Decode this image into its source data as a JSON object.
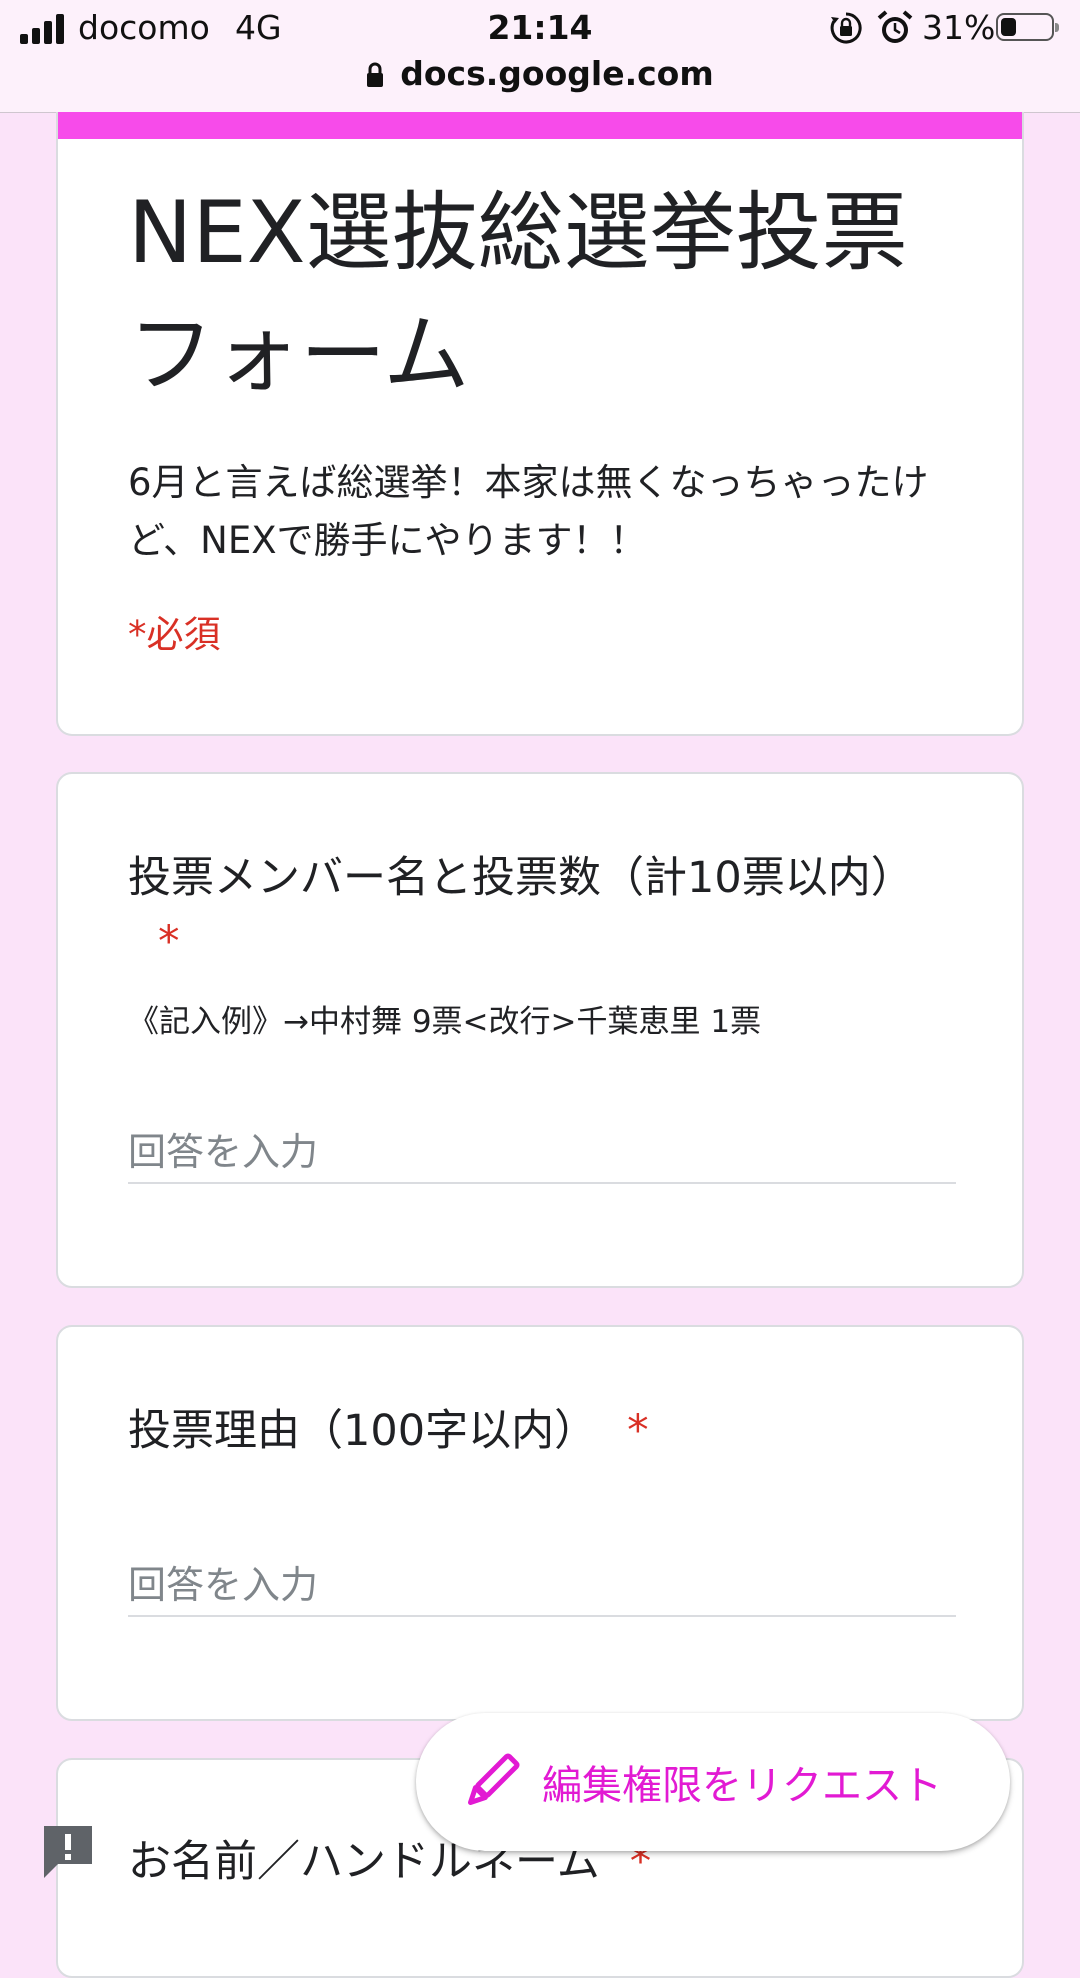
{
  "status_bar": {
    "carrier": "docomo",
    "network": "4G",
    "time": "21:14",
    "battery_percent": "31%",
    "battery_level": 0.31,
    "icons": [
      "signal-bars-icon",
      "rotation-lock-icon",
      "alarm-icon",
      "battery-icon"
    ]
  },
  "browser": {
    "url": "docs.google.com",
    "icon": "lock-icon"
  },
  "form": {
    "accent_color": "#f74bea",
    "title": "NEX選抜総選挙投票フォーム",
    "description": "6月と言えば総選挙！本家は無くなっちゃったけど、NEXで勝手にやります！！",
    "required_note": "*必須"
  },
  "questions": [
    {
      "title": "投票メンバー名と投票数（計10票以内）",
      "required_mark": "*",
      "help": "《記入例》→中村舞 9票<改行>千葉恵里 1票",
      "placeholder": "回答を入力"
    },
    {
      "title": "投票理由（100字以内）",
      "required_mark": "*",
      "placeholder": "回答を入力"
    },
    {
      "title": "お名前／ハンドルネーム",
      "required_mark": "*"
    }
  ],
  "fab": {
    "label": "編集権限をリクエスト",
    "icon": "pencil-icon",
    "color": "#e21ad3"
  },
  "feedback": {
    "icon": "report-problem-icon"
  }
}
